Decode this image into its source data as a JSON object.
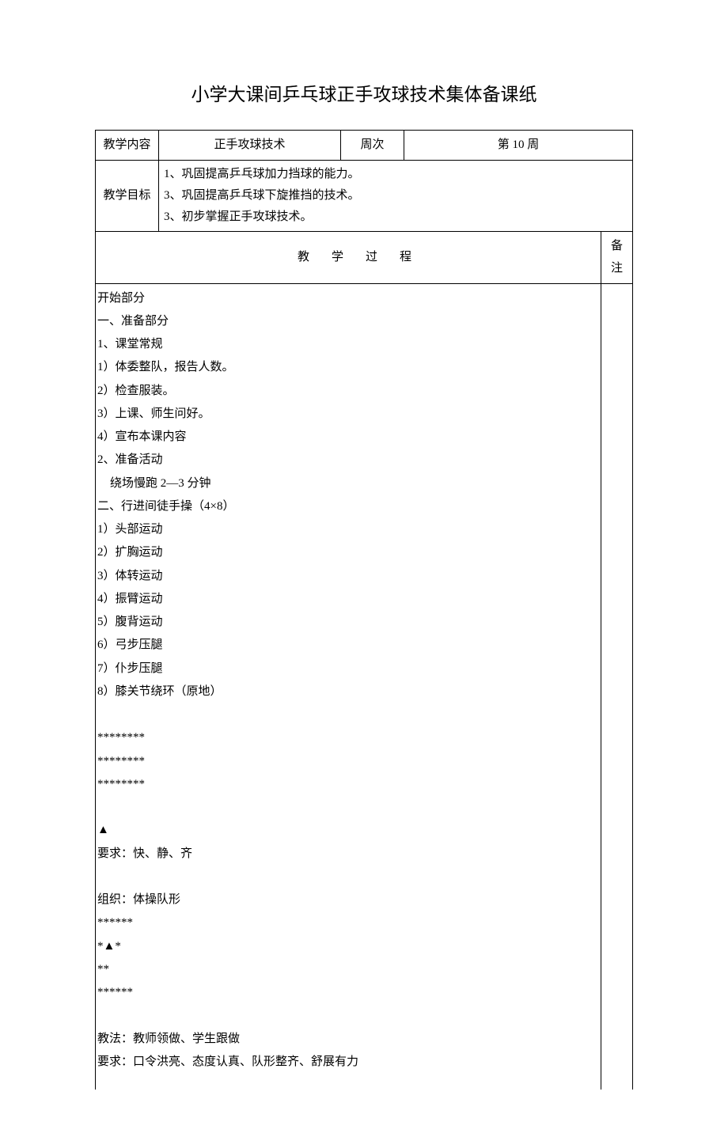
{
  "title": "小学大课间乒乓球正手攻球技术集体备课纸",
  "row1": {
    "label": "教学内容",
    "value": "正手攻球技术",
    "week_label": "周次",
    "week_value": "第 10 周"
  },
  "row2": {
    "label": "教学目标",
    "lines": [
      "1、巩固提高乒乓球加力挡球的能力。",
      "3、巩固提高乒乓球下旋推挡的技术。",
      "3、初步掌握正手攻球技术。"
    ]
  },
  "process_header": "教学过程",
  "remark_header": "备注",
  "content": [
    {
      "t": "开始部分"
    },
    {
      "t": "一、准备部分"
    },
    {
      "t": "1、课堂常规"
    },
    {
      "t": "1）体委整队，报告人数。"
    },
    {
      "t": "2）检查服装。"
    },
    {
      "t": "3）上课、师生问好。"
    },
    {
      "t": "4）宣布本课内容"
    },
    {
      "t": "2、准备活动"
    },
    {
      "t": "绕场慢跑 2—3 分钟",
      "indent": true
    },
    {
      "t": "二、行进间徒手操（4×8）"
    },
    {
      "t": "1）头部运动"
    },
    {
      "t": "2）扩胸运动"
    },
    {
      "t": "3）体转运动"
    },
    {
      "t": "4）振臂运动"
    },
    {
      "t": "5）腹背运动"
    },
    {
      "t": "6）弓步压腿"
    },
    {
      "t": "7）仆步压腿"
    },
    {
      "t": "8）膝关节绕环（原地）"
    },
    {
      "blank": true
    },
    {
      "t": "********"
    },
    {
      "t": "********"
    },
    {
      "t": "********"
    },
    {
      "blank": true
    },
    {
      "t": "▲"
    },
    {
      "t": "要求：快、静、齐"
    },
    {
      "blank": true
    },
    {
      "t": "组织：体操队形"
    },
    {
      "t": "******"
    },
    {
      "t": "*▲*"
    },
    {
      "t": "**"
    },
    {
      "t": "******"
    },
    {
      "blank": true
    },
    {
      "t": "教法：教师领做、学生跟做"
    },
    {
      "t": "要求：口令洪亮、态度认真、队形整齐、舒展有力"
    }
  ]
}
